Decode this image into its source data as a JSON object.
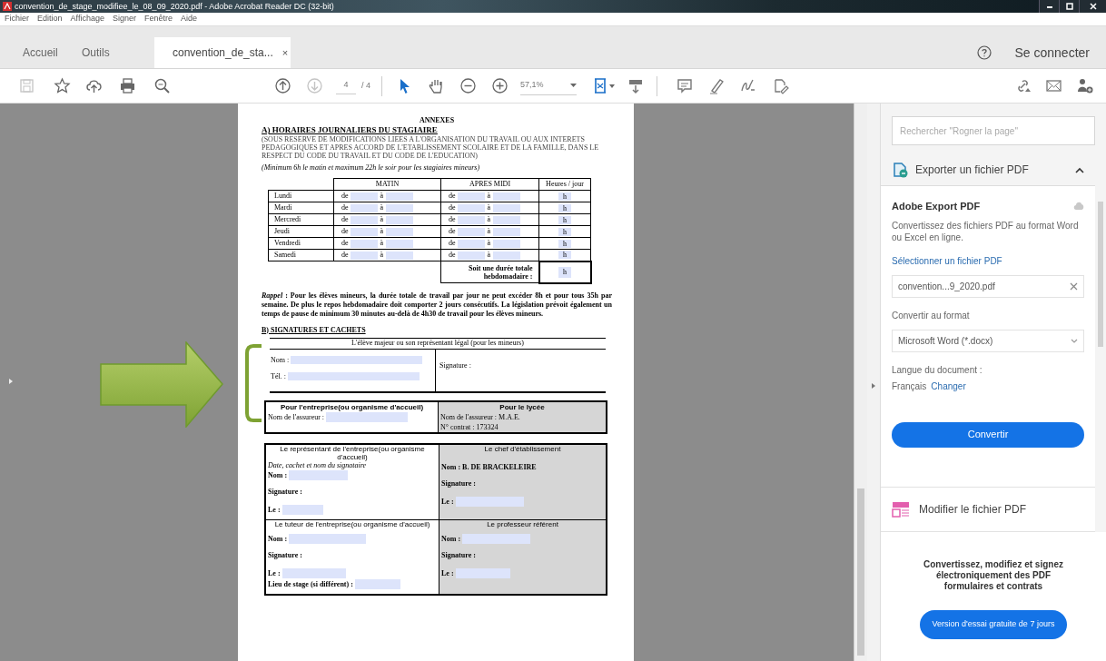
{
  "window": {
    "title": "convention_de_stage_modifiee_le_08_09_2020.pdf - Adobe Acrobat Reader DC (32-bit)"
  },
  "menu": [
    "Fichier",
    "Edition",
    "Affichage",
    "Signer",
    "Fenêtre",
    "Aide"
  ],
  "tabs": [
    {
      "label": "Accueil",
      "selected": false
    },
    {
      "label": "Outils",
      "selected": false
    },
    {
      "label": "convention_de_sta...",
      "selected": true,
      "close": "×"
    }
  ],
  "account": {
    "sign_in": "Se connecter"
  },
  "toolbar": {
    "left": [
      {
        "kind": "save",
        "disabled": true
      },
      {
        "kind": "star",
        "disabled": false
      },
      {
        "kind": "upload",
        "disabled": false
      },
      {
        "kind": "print",
        "disabled": false
      },
      {
        "kind": "zoom-search",
        "disabled": false
      }
    ],
    "nav": [
      {
        "kind": "prev",
        "disabled": false
      },
      {
        "kind": "next",
        "disabled": true
      }
    ],
    "page": "4",
    "page_total": "/ 4",
    "tools": [
      {
        "kind": "select",
        "selected": true
      },
      {
        "kind": "hand",
        "selected": false
      },
      {
        "kind": "zoom-out",
        "selected": false
      },
      {
        "kind": "zoom-in",
        "selected": false
      }
    ],
    "zoom": "57,1%"
  },
  "document": {
    "title": "ANNEXES",
    "section_a": "A) HORAIRES JOURNALIERS DU STAGIAIRE",
    "note": "(SOUS RESERVE DE MODIFICATIONS LIEES A L'ORGANISATION DU TRAVAIL OU AUX INTERETS PEDAGOGIQUES ET APRES ACCORD DE L'ETABLISSEMENT SCOLAIRE ET DE LA FAMILLE, DANS LE RESPECT DU CODE DU TRAVAIL ET DU CODE DE L'EDUCATION)",
    "hours_note": "(Minimum 6h le matin et maximum 22h le soir pour les stagiaires mineurs)",
    "columns": [
      "MATIN",
      "APRES MIDI",
      "Heures / jour"
    ],
    "rows": [
      {
        "day": "Lundi",
        "am_from": "de",
        "am_to": "à",
        "pm_from": "de",
        "pm_to": "à",
        "hours": "h"
      },
      {
        "day": "Mardi",
        "am_from": "de",
        "am_to": "à",
        "pm_from": "de",
        "pm_to": "à",
        "hours": "h"
      },
      {
        "day": "Mercredi",
        "am_from": "de",
        "am_to": "à",
        "pm_from": "de",
        "pm_to": "à",
        "hours": "h"
      },
      {
        "day": "Jeudi",
        "am_from": "de",
        "am_to": "à",
        "pm_from": "de",
        "pm_to": "à",
        "hours": "h"
      },
      {
        "day": "Vendredi",
        "am_from": "de",
        "am_to": "à",
        "pm_from": "de",
        "pm_to": "à",
        "hours": "h"
      },
      {
        "day": "Samedi",
        "am_from": "de",
        "am_to": "à",
        "pm_from": "de",
        "pm_to": "à",
        "hours": "h"
      }
    ],
    "total_label": "Soit une durée totale hebdomadaire :",
    "total_hours": "h",
    "reminder": "*Rappel* : Pour les élèves mineurs, la durée totale de travail par jour ne peut excéder 8h et pour tous 35h par semaine. De plus le repos hebdomadaire doit comporter 2 jours consécutifs. La législation prévoit également un temps de pause de minimum 30 minutes au-delà de 4h30 de travail pour les élèves mineurs.",
    "section_b": "B) SIGNATURES ET CACHETS",
    "student": {
      "header": "L'élève majeur ou son représentant légal (pour les mineurs)",
      "name": "Nom :",
      "phone": "Tél. :",
      "signature": "Signature :"
    },
    "company": {
      "header": "Pour l'entreprise(ou organisme d'accueil)",
      "insurer": "Nom de l'assureur :"
    },
    "school": {
      "header": "Pour le lycée",
      "insurer": "Nom de l'assureur : M.A.E.",
      "contract": "N° contrat : 173324"
    },
    "representative": {
      "header": "Le représentant de l'entreprise(ou organisme d'accueil)",
      "hint": "Date, cachet et nom du signataire",
      "name": "Nom :",
      "signature": "Signature :",
      "date": "Le :"
    },
    "principal": {
      "header": "Le chef d'établissement",
      "name": "Nom : B. DE BRACKELEIRE",
      "signature": "Signature :",
      "date": "Le :"
    },
    "tutor": {
      "header": "Le tuteur de l'entreprise(ou organisme d'accueil)",
      "name": "Nom :",
      "signature": "Signature :",
      "date": "Le :",
      "place": "Lieu de stage (si différent) :"
    },
    "teacher": {
      "header": "Le professeur référent",
      "name": "Nom :",
      "signature": "Signature :",
      "date": "Le :"
    }
  },
  "panel": {
    "search": {
      "placeholder": "Rechercher \"Rogner la page\""
    },
    "export": {
      "title": "Exporter un fichier PDF",
      "expanded": true,
      "service": "Adobe Export PDF",
      "description": "Convertissez des fichiers PDF au format Word ou Excel en ligne.",
      "select_link": "Sélectionner un fichier PDF",
      "file": "convention...9_2020.pdf",
      "format_label": "Convertir au format",
      "format": "Microsoft Word (*.docx)",
      "language_label": "Langue du document :",
      "language": "Français",
      "change_link": "Changer",
      "convert_button": "Convertir"
    },
    "edit_tool": "Modifier le fichier PDF",
    "promo": {
      "text": "Convertissez, modifiez et signez électroniquement des PDF formulaires et contrats",
      "button": "Version d'essai gratuite de 7 jours"
    }
  }
}
